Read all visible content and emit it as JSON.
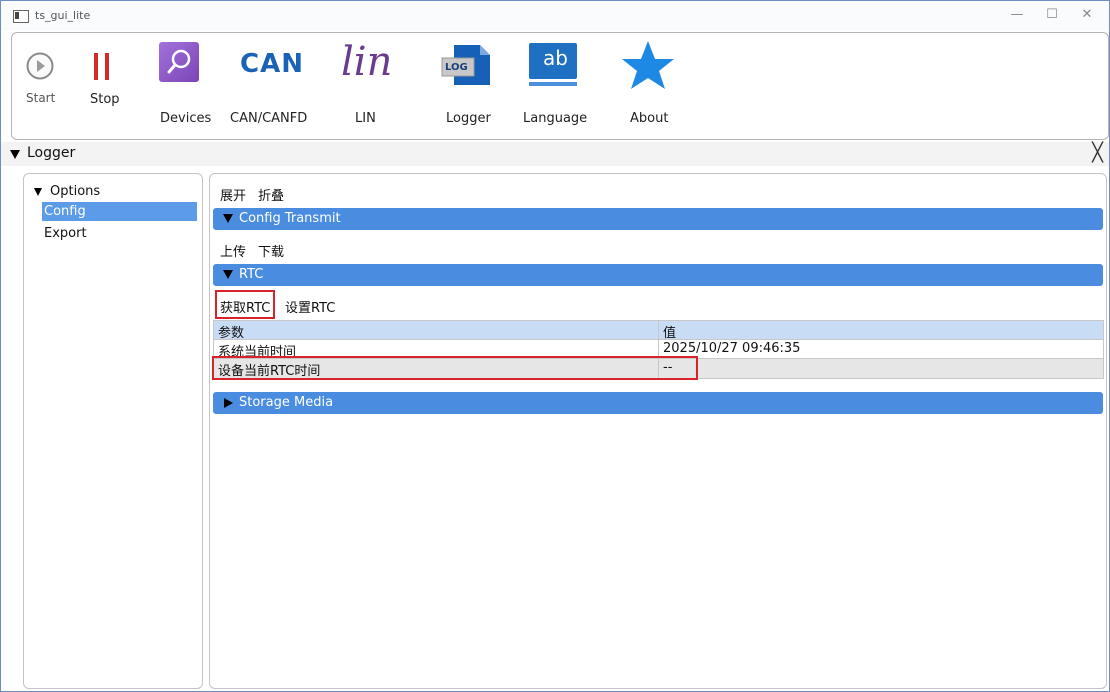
{
  "window": {
    "title": "ts_gui_lite",
    "minimize": "—",
    "maximize": "☐",
    "close": "✕"
  },
  "toolbar": {
    "buttons": [
      {
        "label": "Start",
        "icon": "play-circle-icon"
      },
      {
        "label": "Stop",
        "icon": "pause-icon"
      },
      {
        "label": "Devices",
        "icon": "search-icon"
      },
      {
        "label": "CAN/CANFD",
        "icon": "can-icon",
        "icon_text": "CAN"
      },
      {
        "label": "LIN",
        "icon": "lin-icon",
        "icon_text": "lin"
      },
      {
        "label": "Logger",
        "icon": "log-icon",
        "icon_text": "LOG"
      },
      {
        "label": "Language",
        "icon": "language-icon",
        "icon_text": "ab"
      },
      {
        "label": "About",
        "icon": "star-icon"
      }
    ]
  },
  "panel": {
    "title": "Logger",
    "close": "╳"
  },
  "sidebar": {
    "root": "Options",
    "items": [
      {
        "label": "Config",
        "selected": true
      },
      {
        "label": "Export",
        "selected": false
      }
    ]
  },
  "main": {
    "expand": "展开",
    "collapse": "折叠",
    "config_section": "Config Transmit",
    "upload": "上传",
    "download": "下载",
    "rtc_section": "RTC",
    "get_rtc": "获取RTC",
    "set_rtc": "设置RTC",
    "table": {
      "headers": [
        "参数",
        "值"
      ],
      "rows": [
        [
          "系统当前时间",
          "2025/10/27 09:46:35"
        ],
        [
          "设备当前RTC时间",
          "--"
        ]
      ]
    },
    "storage_section": "Storage Media"
  },
  "colors": {
    "accent": "#4a8de0",
    "selection": "#5b9be8",
    "table_header": "#c9dcf6",
    "highlight_row": "#e6e6e6",
    "annotation": "#d8232a",
    "stop_red": "#d42a2a",
    "devices_purple": "#8c54c5",
    "can_blue": "#1a62b6",
    "lin_purple": "#6a3c8e",
    "star_blue": "#1e88e5"
  }
}
